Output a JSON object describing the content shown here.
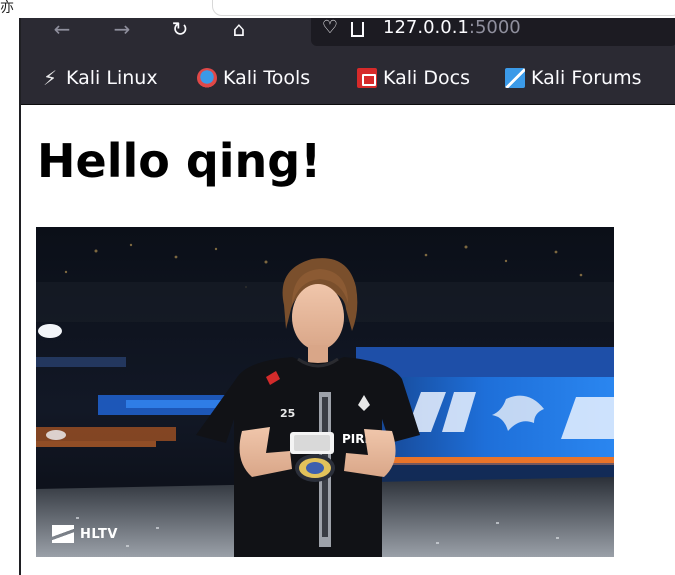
{
  "browser": {
    "url_host": "127.0.0.1",
    "url_port": ":5000",
    "nav": {
      "back_icon": "arrow-left-icon",
      "forward_icon": "arrow-right-icon",
      "reload_icon": "reload-icon",
      "home_icon": "home-icon"
    },
    "bookmarks": [
      {
        "label": "Kali Linux",
        "icon": "kali-dragon-icon"
      },
      {
        "label": "Kali Tools",
        "icon": "kali-tools-icon"
      },
      {
        "label": "Kali Docs",
        "icon": "kali-docs-icon"
      },
      {
        "label": "Kali Forums",
        "icon": "kali-forums-icon"
      }
    ]
  },
  "page": {
    "heading": "Hello qing!",
    "image": {
      "subject": "player in black jersey holding a medal in an esports arena",
      "watermark": "HLTV",
      "jersey_text": "PIRIT",
      "jersey_number": "25"
    }
  },
  "colors": {
    "toolbar": "#2b2a33",
    "urlbar": "#1c1b22",
    "toolbar_text": "#fbfbfe",
    "page_background": "#ffffff",
    "heading": "#000000",
    "arena_blue": "#1e6fd9",
    "arena_orange": "#e8742a"
  }
}
